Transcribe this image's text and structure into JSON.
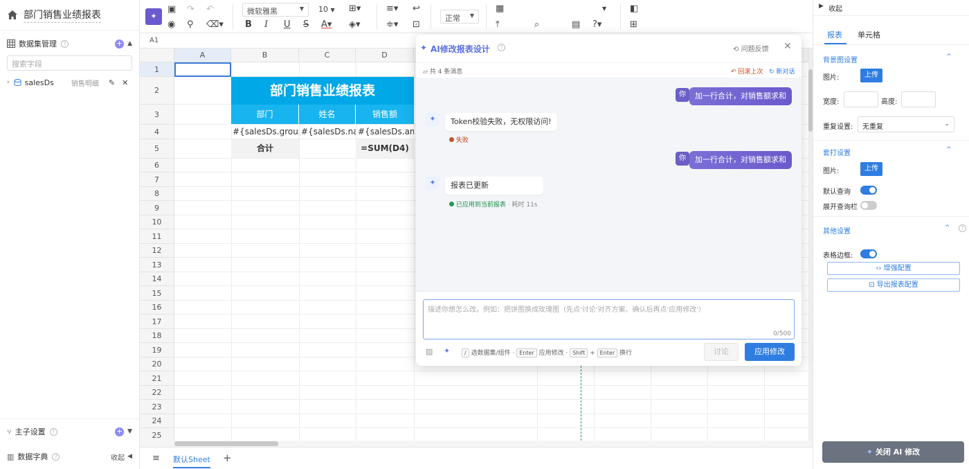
{
  "app": {
    "title": "部门销售业绩报表"
  },
  "left": {
    "dataset_title": "数据集管理",
    "search_placeholder": "搜索字段",
    "dataset": {
      "name": "salesDs",
      "desc": "销售明细"
    },
    "master_title": "主子设置",
    "dict_title": "数据字典",
    "collapse": "收起"
  },
  "toolbar": {
    "font": "微软雅黑",
    "size": "10",
    "format": "正常"
  },
  "formula": {
    "cell_ref": "A1"
  },
  "grid": {
    "columns": [
      "A",
      "B",
      "C",
      "D"
    ],
    "rows": [
      "1",
      "2",
      "3",
      "4",
      "5",
      "6",
      "7",
      "8",
      "9",
      "10",
      "11",
      "12",
      "13",
      "14",
      "15",
      "16",
      "17",
      "18",
      "19",
      "20",
      "21",
      "22",
      "23",
      "24",
      "25"
    ],
    "report_title": "部门销售业绩报表",
    "headers": [
      "部门",
      "姓名",
      "销售额"
    ],
    "row4": [
      "#{salesDs.group(",
      "#{salesDs.nam",
      "#{salesDs.amo"
    ],
    "row5": [
      "合计",
      "",
      "=SUM(D4)"
    ]
  },
  "tabs": {
    "sheet": "默认Sheet",
    "add": "+"
  },
  "right": {
    "collapse": "收起",
    "tabs": [
      "报表",
      "单元格"
    ],
    "bg_title": "背景图设置",
    "image_label": "图片:",
    "upload": "上传",
    "width_label": "宽度:",
    "height_label": "高度:",
    "repeat_label": "重复设置:",
    "repeat_value": "无重复",
    "print_title": "套打设置",
    "default_query": "默认查询",
    "expand_query": "展开查询栏",
    "other_title": "其他设置",
    "table_border": "表格边框:",
    "enhance": "增强配置",
    "export": "导出报表配置",
    "close_ai": "关闭 AI 修改"
  },
  "dialog": {
    "title": "AI修改报表设计",
    "feedback": "问题反馈",
    "count": "共 4 条消息",
    "rollback": "回滚上次",
    "new_chat": "新对话",
    "you": "你",
    "msg1": "加一行合计，对销售额求和",
    "reply1": "Token校验失败，无权限访问!",
    "status1": "失败",
    "msg2": "加一行合计，对销售额求和",
    "reply2": "报表已更新",
    "status2": "已应用到当前报表",
    "elapsed": "· 耗时 11s",
    "placeholder": "描述你想怎么改。例如：把饼图换成玫瑰图（先点'讨论'对齐方案、确认后再点'应用修改'）",
    "counter": "0/500",
    "hint_slash": "/",
    "hint1": "选数据集/组件 ·",
    "kbd_enter": "Enter",
    "hint2": "应用修改 ·",
    "kbd_shift": "Shift",
    "plus": "+",
    "hint3": "换行",
    "discuss": "讨论",
    "apply": "应用修改"
  },
  "colors": {
    "accent": "#2f7de1",
    "title_cell": "#00a8e8",
    "header_cell": "#18b4ef",
    "purple": "#6a5acd"
  }
}
